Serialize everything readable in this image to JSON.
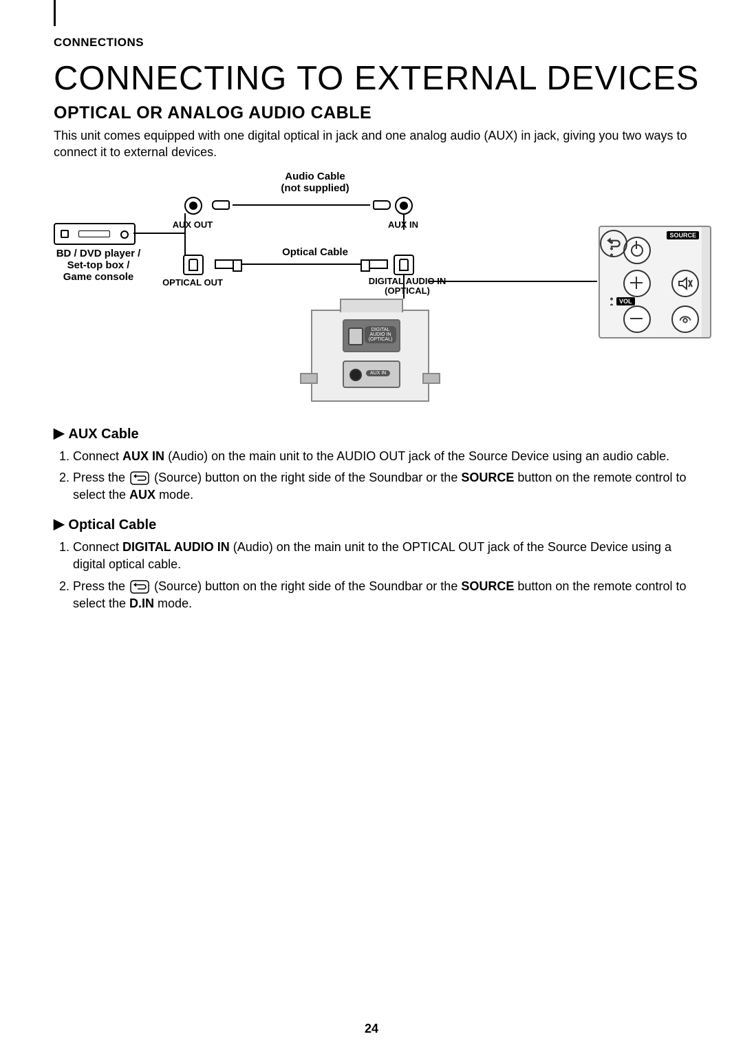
{
  "header": {
    "section": "CONNECTIONS"
  },
  "title": "CONNECTING TO EXTERNAL DEVICES",
  "subtitle": "OPTICAL OR ANALOG AUDIO CABLE",
  "intro": "This unit comes equipped with one digital optical in jack and one analog audio (AUX) in jack, giving you two ways to connect it to external devices.",
  "diagram": {
    "audio_cable_l1": "Audio Cable",
    "audio_cable_l2": "not supplied)",
    "audio_cable_prefix": "(",
    "aux_out": "AUX OUT",
    "aux_in": "AUX IN",
    "source_device_l1": "BD / DVD player /",
    "source_device_l2": "Set-top box /",
    "source_device_l3": "Game console",
    "optical_cable": "Optical Cable",
    "optical_out": "OPTICAL OUT",
    "digital_audio_in_l1": "DIGITAL AUDIO IN",
    "digital_audio_in_l2": "(OPTICAL)",
    "back_dig_label": "DIGITAL AUDIO IN (OPTICAL)",
    "back_aux_label": "AUX IN",
    "side_panel": {
      "source": "SOURCE",
      "vol": "VOL"
    }
  },
  "aux_section": {
    "heading": "AUX Cable",
    "step1_pre": "Connect ",
    "step1_b1": "AUX IN",
    "step1_post": " (Audio) on the main unit to the AUDIO OUT jack of the Source Device using an audio cable.",
    "step2_pre": "Press the ",
    "step2_mid": " (Source) button on the right side of the Soundbar or the ",
    "step2_b1": "SOURCE",
    "step2_mid2": " button on the remote control to select the ",
    "step2_b2": "AUX",
    "step2_post": " mode."
  },
  "optical_section": {
    "heading": "Optical Cable",
    "step1_pre": "Connect ",
    "step1_b1": "DIGITAL AUDIO IN",
    "step1_post": " (Audio) on the main unit to the OPTICAL OUT jack of the Source Device using a digital optical cable.",
    "step2_pre": "Press the ",
    "step2_mid": " (Source) button on the right side of the Soundbar or the ",
    "step2_b1": "SOURCE",
    "step2_mid2": " button on the remote control to select the ",
    "step2_b2": "D.IN",
    "step2_post": " mode."
  },
  "page_number": "24"
}
